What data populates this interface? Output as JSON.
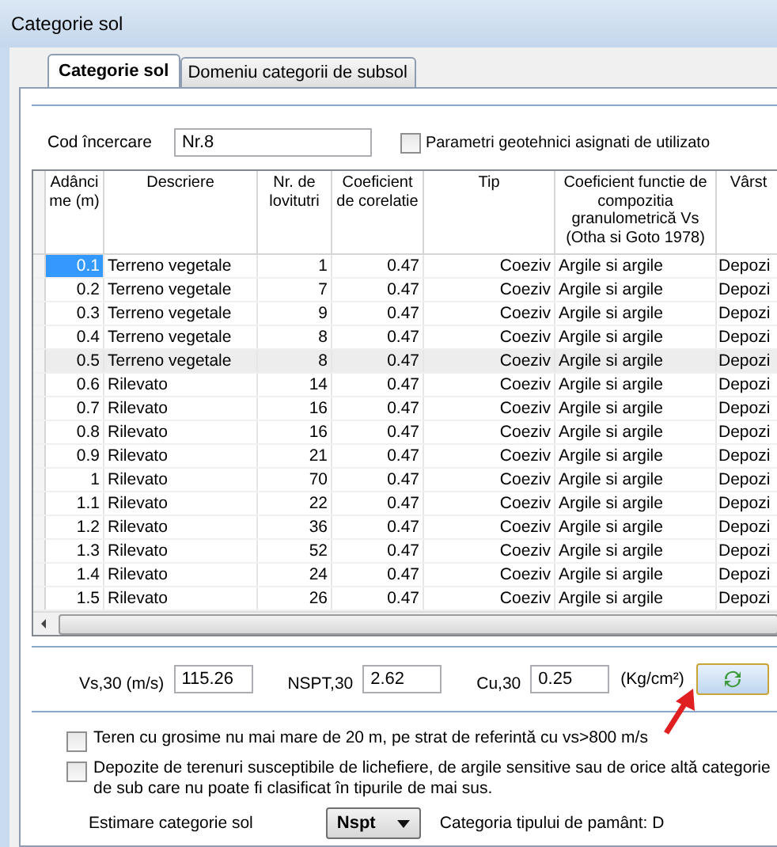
{
  "window": {
    "title": "Categorie sol"
  },
  "tabs": [
    {
      "label": "Categorie sol",
      "selected": true
    },
    {
      "label": "Domeniu categorii de subsol",
      "selected": false
    }
  ],
  "test_code": {
    "label": "Cod încercare",
    "value": "Nr.8"
  },
  "user_params": {
    "label": "Parametri geotehnici asignati de utilizato",
    "checked": false
  },
  "table": {
    "columns": [
      "Adânci me (m)",
      "Descriere",
      "Nr. de lovitutri",
      "Coeficient de corelatie",
      "Tip",
      "Coeficient functie de compozitia granulometrică Vs (Otha si Goto 1978)",
      "Vârst"
    ],
    "rows": [
      {
        "cells": [
          "0.1",
          "Terreno vegetale",
          "1",
          "0.47",
          "Coeziv",
          "Argile si argile",
          "Depozi"
        ],
        "selected": true,
        "hovered": false
      },
      {
        "cells": [
          "0.2",
          "Terreno vegetale",
          "7",
          "0.47",
          "Coeziv",
          "Argile si argile",
          "Depozi"
        ],
        "selected": false,
        "hovered": false
      },
      {
        "cells": [
          "0.3",
          "Terreno vegetale",
          "9",
          "0.47",
          "Coeziv",
          "Argile si argile",
          "Depozi"
        ],
        "selected": false,
        "hovered": false
      },
      {
        "cells": [
          "0.4",
          "Terreno vegetale",
          "8",
          "0.47",
          "Coeziv",
          "Argile si argile",
          "Depozi"
        ],
        "selected": false,
        "hovered": false
      },
      {
        "cells": [
          "0.5",
          "Terreno vegetale",
          "8",
          "0.47",
          "Coeziv",
          "Argile si argile",
          "Depozi"
        ],
        "selected": false,
        "hovered": true
      },
      {
        "cells": [
          "0.6",
          "Rilevato",
          "14",
          "0.47",
          "Coeziv",
          "Argile si argile",
          "Depozi"
        ],
        "selected": false,
        "hovered": false
      },
      {
        "cells": [
          "0.7",
          "Rilevato",
          "16",
          "0.47",
          "Coeziv",
          "Argile si argile",
          "Depozi"
        ],
        "selected": false,
        "hovered": false
      },
      {
        "cells": [
          "0.8",
          "Rilevato",
          "16",
          "0.47",
          "Coeziv",
          "Argile si argile",
          "Depozi"
        ],
        "selected": false,
        "hovered": false
      },
      {
        "cells": [
          "0.9",
          "Rilevato",
          "21",
          "0.47",
          "Coeziv",
          "Argile si argile",
          "Depozi"
        ],
        "selected": false,
        "hovered": false
      },
      {
        "cells": [
          "1",
          "Rilevato",
          "70",
          "0.47",
          "Coeziv",
          "Argile si argile",
          "Depozi"
        ],
        "selected": false,
        "hovered": false
      },
      {
        "cells": [
          "1.1",
          "Rilevato",
          "22",
          "0.47",
          "Coeziv",
          "Argile si argile",
          "Depozi"
        ],
        "selected": false,
        "hovered": false
      },
      {
        "cells": [
          "1.2",
          "Rilevato",
          "36",
          "0.47",
          "Coeziv",
          "Argile si argile",
          "Depozi"
        ],
        "selected": false,
        "hovered": false
      },
      {
        "cells": [
          "1.3",
          "Rilevato",
          "52",
          "0.47",
          "Coeziv",
          "Argile si argile",
          "Depozi"
        ],
        "selected": false,
        "hovered": false
      },
      {
        "cells": [
          "1.4",
          "Rilevato",
          "24",
          "0.47",
          "Coeziv",
          "Argile si argile",
          "Depozi"
        ],
        "selected": false,
        "hovered": false
      },
      {
        "cells": [
          "1.5",
          "Rilevato",
          "26",
          "0.47",
          "Coeziv",
          "Argile si argile",
          "Depozi"
        ],
        "selected": false,
        "hovered": false
      }
    ]
  },
  "results": [
    {
      "label": "Vs,30 (m/s)",
      "value": "115.26"
    },
    {
      "label": "NSPT,30",
      "value": "2.62"
    },
    {
      "label": "Cu,30",
      "value": "0.25"
    }
  ],
  "unit": "(Kg/cm²)",
  "options": [
    {
      "label": "Teren cu grosime nu mai mare de 20 m, pe strat de referintă cu vs>800 m/s",
      "checked": false
    },
    {
      "label": "Depozite de terenuri susceptibile de lichefiere, de argile sensitive sau de orice altă categorie de sub care nu poate fi clasificat în tipurile de mai sus.",
      "checked": false
    }
  ],
  "estimate": {
    "label": "Estimare categorie sol",
    "value": "Nspt",
    "result": "Categoria tipului de pamânt: D"
  }
}
